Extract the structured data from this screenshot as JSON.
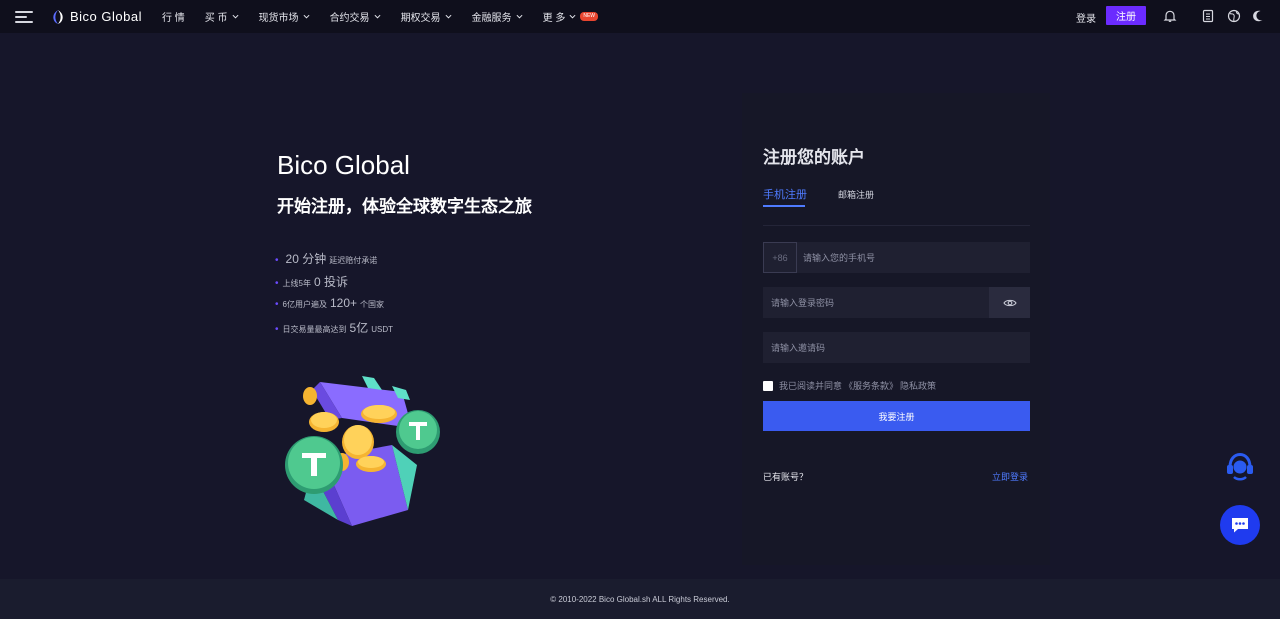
{
  "brand": {
    "name": "Bico Global"
  },
  "nav": {
    "items": [
      {
        "label": "行 情",
        "has_menu": false
      },
      {
        "label": "买 币",
        "has_menu": true
      },
      {
        "label": "现货市场",
        "has_menu": true
      },
      {
        "label": "合约交易",
        "has_menu": true
      },
      {
        "label": "期权交易",
        "has_menu": true
      },
      {
        "label": "金融服务",
        "has_menu": true
      },
      {
        "label": "更 多",
        "has_menu": true,
        "badge": "NEW"
      }
    ]
  },
  "header": {
    "login_label": "登录",
    "register_label": "注册",
    "icons": [
      "bell-icon",
      "document-icon",
      "globe-icon",
      "moon-icon"
    ]
  },
  "hero": {
    "title": "Bico Global",
    "subtitle": "开始注册，体验全球数字生态之旅",
    "features": [
      {
        "pre": "",
        "big": "20 分钟",
        "post": "延迟赔付承诺"
      },
      {
        "pre": "上线5年",
        "big": "0 投诉",
        "post": ""
      },
      {
        "pre": "6亿用户遍及",
        "big": "120+",
        "post": "个国家"
      },
      {
        "pre": "日交易量最高达到",
        "big": "5亿",
        "post": "USDT"
      }
    ]
  },
  "form": {
    "title": "注册您的账户",
    "tab_phone": "手机注册",
    "tab_email": "邮箱注册",
    "phone_prefix": "+86",
    "phone_placeholder": "请输入您的手机号",
    "password_placeholder": "请输入登录密码",
    "invite_placeholder": "请输入邀请码",
    "agree_text": "我已阅读并同意",
    "agree_terms": "《服务条款》",
    "agree_privacy": "隐私政策",
    "submit_label": "我要注册",
    "has_account": "已有账号？",
    "login_now": "立即登录"
  },
  "footer": {
    "copyright": "© 2010-2022 Bico Global.sh ALL Rights Reserved."
  },
  "colors": {
    "accent_purple": "#6b2bff",
    "accent_blue": "#3a5bf0",
    "link_blue": "#4f7bff",
    "badge_red": "#e8452f",
    "background": "#16162a"
  }
}
